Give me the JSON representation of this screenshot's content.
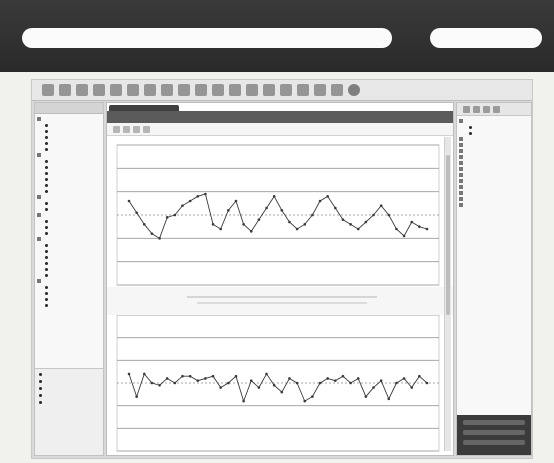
{
  "window": {
    "title": "",
    "tab_label": ""
  },
  "colors": {
    "topbar_bg": "#2f2f2f",
    "pill_bg": "#fbfbfb",
    "chart_line": "#3a3a3a",
    "grid_solid": "#9a9a9a",
    "grid_dotted": "#8a8a8a"
  },
  "toolbar": {
    "icons": [
      "tool-icon",
      "tool-icon",
      "tool-icon",
      "tool-icon",
      "tool-icon",
      "tool-icon",
      "tool-icon",
      "tool-icon",
      "tool-icon",
      "tool-icon",
      "tool-icon",
      "tool-icon",
      "tool-icon",
      "tool-icon",
      "tool-icon",
      "tool-icon",
      "tool-icon",
      "tool-icon",
      "circle-icon"
    ]
  },
  "left_panel": {
    "header": "",
    "groups": [
      {
        "label": "",
        "items": [
          "",
          "",
          "",
          "",
          ""
        ]
      },
      {
        "label": "",
        "items": [
          "",
          "",
          "",
          "",
          "",
          ""
        ]
      },
      {
        "label": "",
        "items": [
          "",
          ""
        ]
      },
      {
        "label": "",
        "items": [
          "",
          "",
          ""
        ]
      },
      {
        "label": "",
        "items": [
          "",
          "",
          "",
          "",
          "",
          ""
        ]
      },
      {
        "label": "",
        "items": [
          "",
          "",
          "",
          ""
        ]
      }
    ],
    "bottom_items": [
      "",
      "",
      "",
      "",
      ""
    ]
  },
  "right_panel": {
    "header": "",
    "items": [
      {
        "kind": "group",
        "label": ""
      },
      {
        "kind": "item",
        "label": ""
      },
      {
        "kind": "item",
        "label": ""
      },
      {
        "kind": "group",
        "label": ""
      },
      {
        "kind": "group",
        "label": ""
      },
      {
        "kind": "group",
        "label": ""
      },
      {
        "kind": "group",
        "label": ""
      },
      {
        "kind": "group",
        "label": ""
      },
      {
        "kind": "group",
        "label": ""
      },
      {
        "kind": "group",
        "label": ""
      },
      {
        "kind": "group",
        "label": ""
      },
      {
        "kind": "group",
        "label": ""
      },
      {
        "kind": "group",
        "label": ""
      },
      {
        "kind": "group",
        "label": ""
      },
      {
        "kind": "group",
        "label": ""
      }
    ]
  },
  "chart_data": [
    {
      "type": "line",
      "title": "",
      "x": [
        1,
        2,
        3,
        4,
        5,
        6,
        7,
        8,
        9,
        10,
        11,
        12,
        13,
        14,
        15,
        16,
        17,
        18,
        19,
        20,
        21,
        22,
        23,
        24,
        25,
        26,
        27,
        28,
        29,
        30,
        31,
        32,
        33,
        34,
        35,
        36,
        37,
        38,
        39,
        40
      ],
      "values": [
        0.6,
        0.1,
        -0.4,
        -0.8,
        -1.0,
        -0.1,
        0.0,
        0.4,
        0.6,
        0.8,
        0.9,
        -0.4,
        -0.6,
        0.2,
        0.6,
        -0.4,
        -0.7,
        -0.2,
        0.3,
        0.8,
        0.2,
        -0.3,
        -0.6,
        -0.4,
        0.0,
        0.6,
        0.8,
        0.3,
        -0.2,
        -0.4,
        -0.6,
        -0.3,
        0.0,
        0.4,
        0.0,
        -0.6,
        -0.9,
        -0.3,
        -0.5,
        -0.6
      ],
      "ylim": [
        -3,
        3
      ],
      "grid": true
    },
    {
      "type": "line",
      "title": "",
      "x": [
        1,
        2,
        3,
        4,
        5,
        6,
        7,
        8,
        9,
        10,
        11,
        12,
        13,
        14,
        15,
        16,
        17,
        18,
        19,
        20,
        21,
        22,
        23,
        24,
        25,
        26,
        27,
        28,
        29,
        30,
        31,
        32,
        33,
        34,
        35,
        36,
        37,
        38,
        39,
        40
      ],
      "values": [
        0.4,
        -0.6,
        0.4,
        0.0,
        -0.1,
        0.2,
        0.0,
        0.3,
        0.3,
        0.1,
        0.2,
        0.3,
        -0.2,
        0.0,
        0.3,
        -0.8,
        0.1,
        -0.2,
        0.4,
        -0.1,
        -0.4,
        0.2,
        0.0,
        -0.8,
        -0.6,
        0.0,
        0.2,
        0.1,
        0.3,
        0.0,
        0.2,
        -0.6,
        -0.2,
        0.1,
        -0.7,
        0.0,
        0.2,
        -0.2,
        0.3,
        0.0
      ],
      "ylim": [
        -3,
        3
      ],
      "grid": true
    }
  ]
}
